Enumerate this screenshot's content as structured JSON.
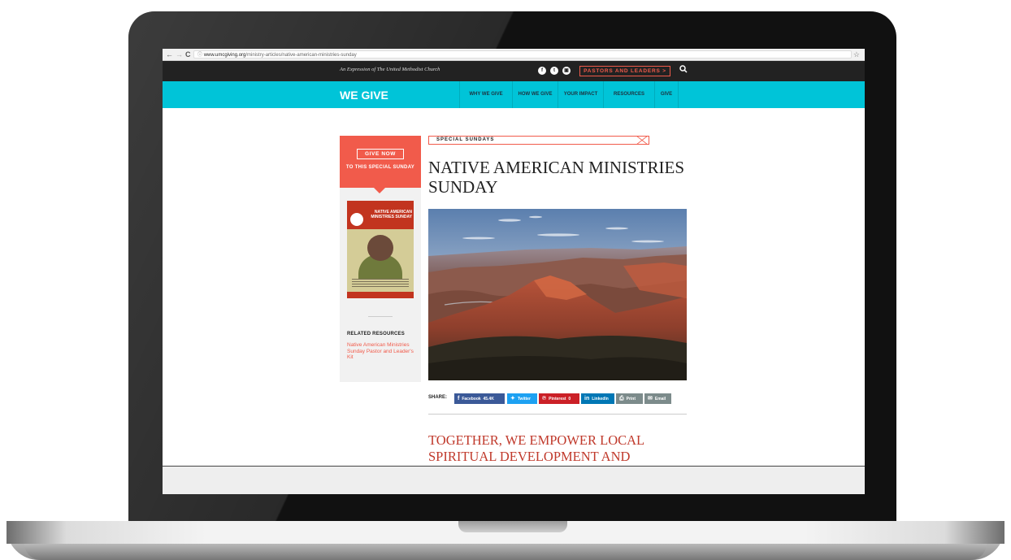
{
  "browser": {
    "back": "←",
    "forward": "→",
    "reload": "C",
    "info": "ⓘ",
    "url_host": "www.umcgiving.org",
    "url_path": "/ministry-articles/native-american-ministries-sunday",
    "star": "☆"
  },
  "topbar": {
    "expression": "An Expression of The United Methodist Church",
    "social": [
      "f",
      "t",
      "▣"
    ],
    "pastors_button": "PASTORS AND LEADERS >",
    "search_icon": "⚲"
  },
  "nav": {
    "logo": "WE GIVE",
    "items": [
      "WHY WE GIVE",
      "HOW WE GIVE",
      "YOUR IMPACT",
      "RESOURCES",
      "GIVE"
    ]
  },
  "sidebar": {
    "give_button": "GIVE NOW",
    "give_sub": "TO THIS SPECIAL SUNDAY",
    "poster_title": "NATIVE AMERICAN MINISTRIES SUNDAY",
    "related_title": "RELATED RESOURCES",
    "related_link": "Native American Ministries Sunday Pastor and Leader's Kit"
  },
  "article": {
    "tag": "SPECIAL SUNDAYS",
    "title": "NATIVE AMERICAN MINISTRIES SUNDAY",
    "share_label": "SHARE:",
    "share": {
      "facebook": "Facebook",
      "facebook_count": "45.4K",
      "twitter": "Twitter",
      "pinterest": "Pinterest",
      "pinterest_count": "0",
      "linkedin": "LinkedIn",
      "print": "Print",
      "email": "Email"
    },
    "subheading": "TOGETHER, WE EMPOWER LOCAL SPIRITUAL DEVELOPMENT AND"
  },
  "colors": {
    "teal": "#00c4d8",
    "coral": "#f15b4b",
    "facebook": "#3b5998",
    "twitter": "#1da1f2",
    "pinterest": "#cb2027",
    "linkedin": "#0077b5",
    "print": "#7c8b8b",
    "email": "#7c8b8b"
  }
}
